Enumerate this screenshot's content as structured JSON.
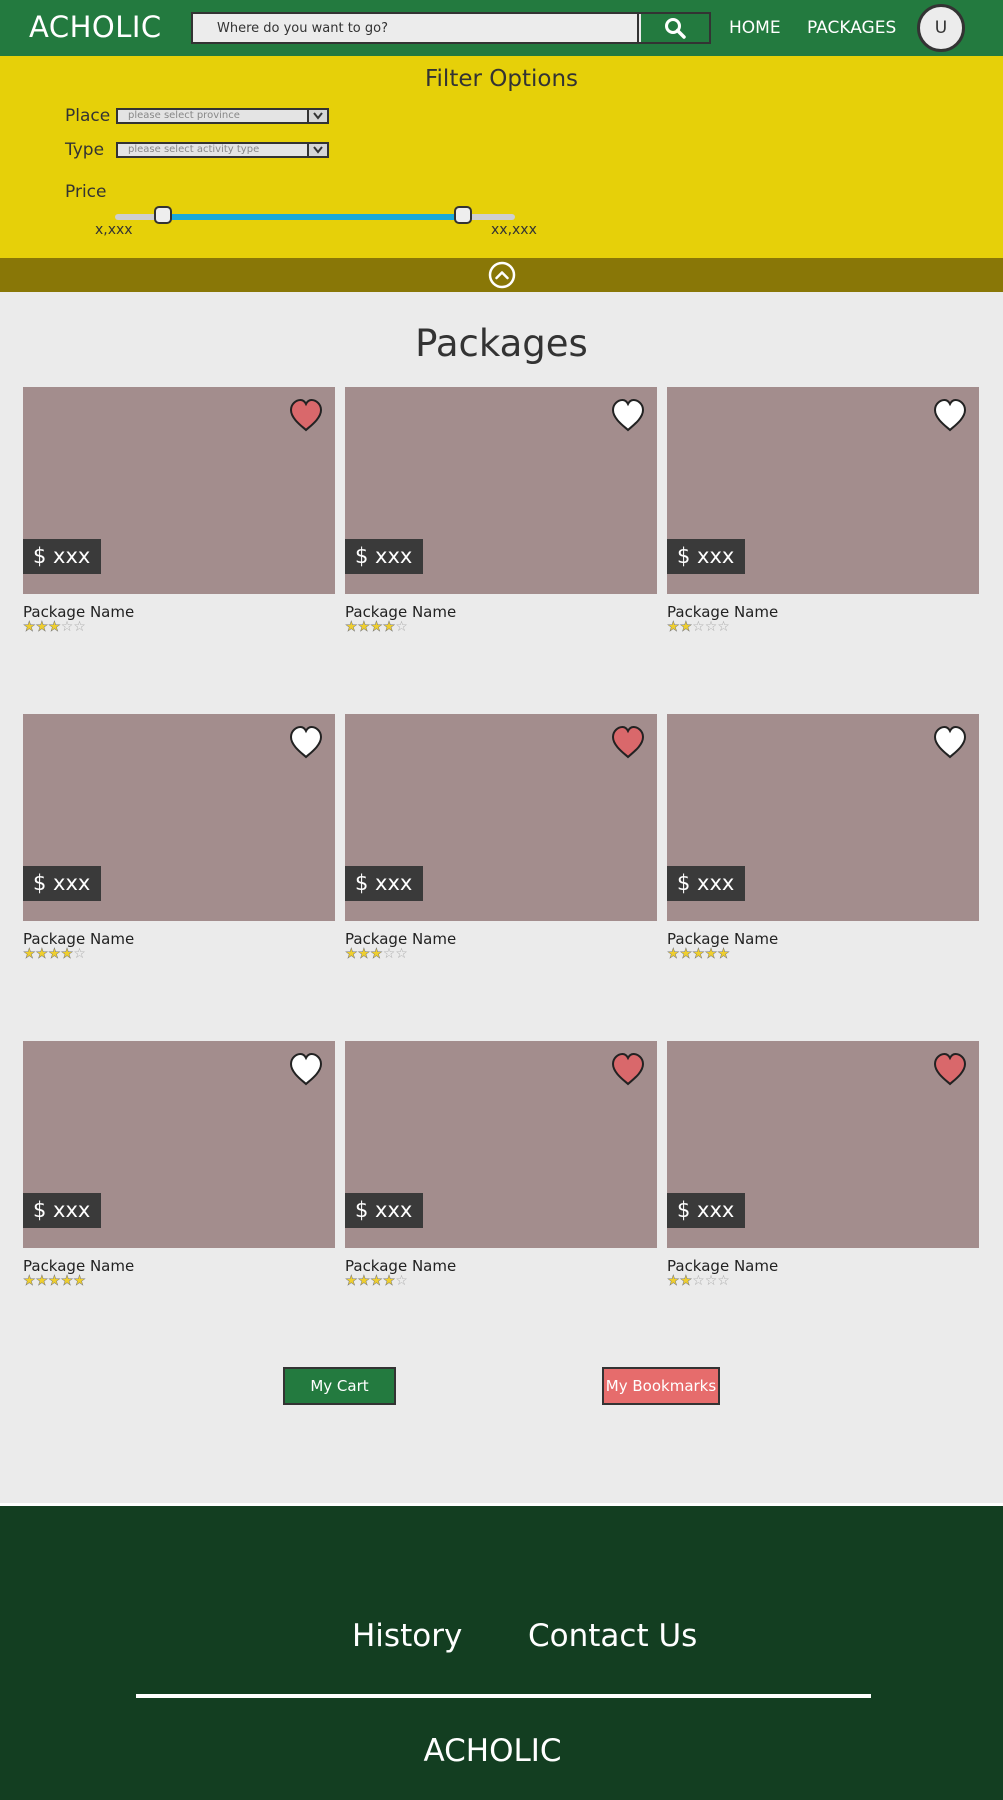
{
  "header": {
    "logo": "ACHOLIC",
    "search_placeholder": "Where do you want to go?",
    "nav": [
      "HOME",
      "PACKAGES"
    ],
    "avatar_initial": "U"
  },
  "filter": {
    "title": "Filter Options",
    "place_label": "Place",
    "place_placeholder": "please select province",
    "type_label": "Type",
    "type_placeholder": "please select activity type",
    "price_label": "Price",
    "price_min": "x,xxx",
    "price_max": "xx,xxx",
    "range_low_fraction": 0.12,
    "range_high_fraction": 0.87
  },
  "packages": {
    "title": "Packages",
    "items": [
      {
        "price": "$ xxx",
        "name": "Package Name",
        "rating": 3,
        "favorited": true
      },
      {
        "price": "$ xxx",
        "name": "Package Name",
        "rating": 4,
        "favorited": false
      },
      {
        "price": "$ xxx",
        "name": "Package Name",
        "rating": 2,
        "favorited": false
      },
      {
        "price": "$ xxx",
        "name": "Package Name",
        "rating": 4,
        "favorited": false
      },
      {
        "price": "$ xxx",
        "name": "Package Name",
        "rating": 3,
        "favorited": true
      },
      {
        "price": "$ xxx",
        "name": "Package Name",
        "rating": 5,
        "favorited": false
      },
      {
        "price": "$ xxx",
        "name": "Package Name",
        "rating": 5,
        "favorited": false
      },
      {
        "price": "$ xxx",
        "name": "Package Name",
        "rating": 4,
        "favorited": true
      },
      {
        "price": "$ xxx",
        "name": "Package Name",
        "rating": 2,
        "favorited": true
      }
    ]
  },
  "actions": {
    "cart": "My Cart",
    "bookmarks": "My Bookmarks"
  },
  "footer": {
    "history": "History",
    "contact": "Contact Us",
    "logo": "ACHOLIC"
  },
  "colors": {
    "header_green": "#237a3f",
    "filter_yellow": "#e6d009",
    "collapse_olive": "#897707",
    "slider_blue": "#1ba9d8",
    "card_placeholder": "#a38d8d",
    "heart_favorited": "#d9686b",
    "bookmark_red": "#e66c6c",
    "footer_green": "#133e21"
  }
}
